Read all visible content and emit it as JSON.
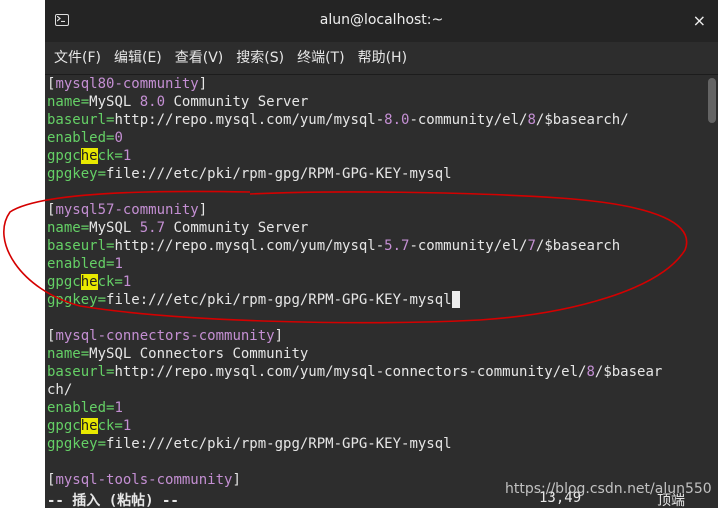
{
  "window": {
    "title": "alun@localhost:~",
    "close_label": "×",
    "icon": "terminal-icon"
  },
  "menu": [
    "文件(F)",
    "编辑(E)",
    "查看(V)",
    "搜索(S)",
    "终端(T)",
    "帮助(H)"
  ],
  "lines": [
    [
      [
        "br",
        "["
      ],
      [
        "sec",
        "mysql80-community"
      ],
      [
        "br",
        "]"
      ]
    ],
    [
      [
        "key",
        "name="
      ],
      [
        "val",
        "MySQL "
      ],
      [
        "num",
        "8.0"
      ],
      [
        "val",
        " Community Server"
      ]
    ],
    [
      [
        "key",
        "baseurl="
      ],
      [
        "val",
        "http://repo.mysql.com/yum/mysql-"
      ],
      [
        "num",
        "8.0"
      ],
      [
        "val",
        "-community/el/"
      ],
      [
        "num",
        "8"
      ],
      [
        "val",
        "/$basearch/"
      ]
    ],
    [
      [
        "key",
        "enabled="
      ],
      [
        "num",
        "0"
      ]
    ],
    [
      [
        "key",
        "gpgc"
      ],
      [
        "hl",
        "he"
      ],
      [
        "key",
        "ck="
      ],
      [
        "num",
        "1"
      ]
    ],
    [
      [
        "key",
        "gpgkey="
      ],
      [
        "val",
        "file:///etc/pki/rpm-gpg/RPM-GPG-KEY-mysql"
      ]
    ],
    [],
    [
      [
        "br",
        "["
      ],
      [
        "sec",
        "mysql57-community"
      ],
      [
        "br",
        "]"
      ]
    ],
    [
      [
        "key",
        "name="
      ],
      [
        "val",
        "MySQL "
      ],
      [
        "num",
        "5.7"
      ],
      [
        "val",
        " Community Server"
      ]
    ],
    [
      [
        "key",
        "baseurl="
      ],
      [
        "val",
        "http://repo.mysql.com/yum/mysql-"
      ],
      [
        "num",
        "5.7"
      ],
      [
        "val",
        "-community/el/"
      ],
      [
        "num",
        "7"
      ],
      [
        "val",
        "/$basearch"
      ]
    ],
    [
      [
        "key",
        "enabled="
      ],
      [
        "num",
        "1"
      ]
    ],
    [
      [
        "key",
        "gpgc"
      ],
      [
        "hl",
        "he"
      ],
      [
        "key",
        "ck="
      ],
      [
        "num",
        "1"
      ]
    ],
    [
      [
        "key",
        "gpgkey="
      ],
      [
        "val",
        "file:///etc/pki/rpm-gpg/RPM-GPG-KEY-mysql"
      ],
      [
        "cursor",
        ""
      ]
    ],
    [],
    [
      [
        "br",
        "["
      ],
      [
        "sec",
        "mysql-connectors-community"
      ],
      [
        "br",
        "]"
      ]
    ],
    [
      [
        "key",
        "name="
      ],
      [
        "val",
        "MySQL Connectors Community"
      ]
    ],
    [
      [
        "key",
        "baseurl="
      ],
      [
        "val",
        "http://repo.mysql.com/yum/mysql-connectors-community/el/"
      ],
      [
        "num",
        "8"
      ],
      [
        "val",
        "/$basear"
      ]
    ],
    [
      [
        "val",
        "ch/"
      ]
    ],
    [
      [
        "key",
        "enabled="
      ],
      [
        "num",
        "1"
      ]
    ],
    [
      [
        "key",
        "gpgc"
      ],
      [
        "hl",
        "he"
      ],
      [
        "key",
        "ck="
      ],
      [
        "num",
        "1"
      ]
    ],
    [
      [
        "key",
        "gpgkey="
      ],
      [
        "val",
        "file:///etc/pki/rpm-gpg/RPM-GPG-KEY-mysql"
      ]
    ],
    [],
    [
      [
        "br",
        "["
      ],
      [
        "sec",
        "mysql-tools-community"
      ],
      [
        "br",
        "]"
      ]
    ]
  ],
  "status": {
    "mode": "-- 插入 (粘帖) --",
    "position": "13,49",
    "scroll": "顶端"
  },
  "watermark": "https://blog.csdn.net/alun550",
  "colors": {
    "annotation": "#d40000",
    "section": "#c48fd3",
    "key": "#65d066",
    "highlight": "#e8e800"
  }
}
